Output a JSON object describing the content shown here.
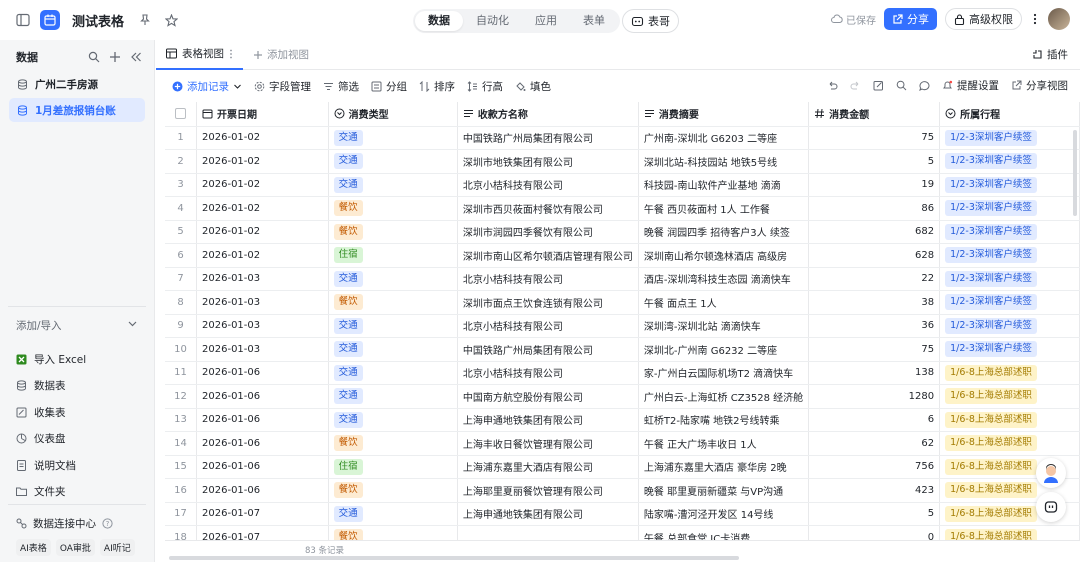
{
  "app": {
    "title": "测试表格"
  },
  "top_tabs": [
    {
      "label": "数据",
      "active": true
    },
    {
      "label": "自动化",
      "active": false
    },
    {
      "label": "应用",
      "active": false
    },
    {
      "label": "表单",
      "active": false
    }
  ],
  "biaoge": "表哥",
  "saved_label": "已保存",
  "share_label": "分享",
  "perm_label": "高级权限",
  "sidebar": {
    "title": "数据",
    "tables": [
      {
        "label": "广州二手房源",
        "active": false
      },
      {
        "label": "1月差旅报销台账",
        "active": true
      }
    ],
    "add_import": "添加/导入",
    "import_items": [
      "导入 Excel",
      "数据表",
      "收集表",
      "仪表盘",
      "说明文档",
      "文件夹"
    ],
    "connect_label": "数据连接中心",
    "chips": [
      "AI表格",
      "OA审批",
      "AI听记"
    ]
  },
  "view": {
    "tab": "表格视图",
    "add": "添加视图",
    "plugin": "插件"
  },
  "toolbar": {
    "add_record": "添加记录",
    "fields": "字段管理",
    "filter": "筛选",
    "group": "分组",
    "sort": "排序",
    "row_height": "行高",
    "fill": "填色",
    "remind": "提醒设置",
    "share_view": "分享视图"
  },
  "columns": [
    "开票日期",
    "消费类型",
    "收款方名称",
    "消费摘要",
    "消费金额",
    "所属行程"
  ],
  "colors": {
    "accent": "#3370ff",
    "tag_交通": "#e1eaff",
    "tag_交通_text": "#245bdb",
    "tag_餐饮": "#fdebd2",
    "tag_餐饮_text": "#c25a00",
    "tag_住宿": "#d9f5d6",
    "tag_住宿_text": "#2e8a1f",
    "trip_a": "#e1eaff",
    "trip_a_text": "#245bdb",
    "trip_b": "#fef3c8",
    "trip_b_text": "#a37b00"
  },
  "rows": [
    {
      "n": "1",
      "date": "2026-01-02",
      "type": "交通",
      "payee": "中国铁路广州局集团有限公司",
      "summary": "广州南-深圳北 G6203 二等座",
      "amount": "75",
      "trip": "1/2-3深圳客户续签"
    },
    {
      "n": "2",
      "date": "2026-01-02",
      "type": "交通",
      "payee": "深圳市地铁集团有限公司",
      "summary": "深圳北站-科技园站 地铁5号线",
      "amount": "5",
      "trip": "1/2-3深圳客户续签"
    },
    {
      "n": "3",
      "date": "2026-01-02",
      "type": "交通",
      "payee": "北京小桔科技有限公司",
      "summary": "科技园-南山软件产业基地 滴滴",
      "amount": "19",
      "trip": "1/2-3深圳客户续签"
    },
    {
      "n": "4",
      "date": "2026-01-02",
      "type": "餐饮",
      "payee": "深圳市西贝莜面村餐饮有限公司",
      "summary": "午餐 西贝莜面村 1人 工作餐",
      "amount": "86",
      "trip": "1/2-3深圳客户续签"
    },
    {
      "n": "5",
      "date": "2026-01-02",
      "type": "餐饮",
      "payee": "深圳市润园四季餐饮有限公司",
      "summary": "晚餐 润园四季 招待客户3人 续签",
      "amount": "682",
      "trip": "1/2-3深圳客户续签"
    },
    {
      "n": "6",
      "date": "2026-01-02",
      "type": "住宿",
      "payee": "深圳市南山区希尔顿酒店管理有限公司",
      "summary": "深圳南山希尔顿逸林酒店 高级房",
      "amount": "628",
      "trip": "1/2-3深圳客户续签"
    },
    {
      "n": "7",
      "date": "2026-01-03",
      "type": "交通",
      "payee": "北京小桔科技有限公司",
      "summary": "酒店-深圳湾科技生态园 滴滴快车",
      "amount": "22",
      "trip": "1/2-3深圳客户续签"
    },
    {
      "n": "8",
      "date": "2026-01-03",
      "type": "餐饮",
      "payee": "深圳市面点王饮食连锁有限公司",
      "summary": "午餐 面点王 1人",
      "amount": "38",
      "trip": "1/2-3深圳客户续签"
    },
    {
      "n": "9",
      "date": "2026-01-03",
      "type": "交通",
      "payee": "北京小桔科技有限公司",
      "summary": "深圳湾-深圳北站 滴滴快车",
      "amount": "36",
      "trip": "1/2-3深圳客户续签"
    },
    {
      "n": "10",
      "date": "2026-01-03",
      "type": "交通",
      "payee": "中国铁路广州局集团有限公司",
      "summary": "深圳北-广州南 G6232 二等座",
      "amount": "75",
      "trip": "1/2-3深圳客户续签"
    },
    {
      "n": "11",
      "date": "2026-01-06",
      "type": "交通",
      "payee": "北京小桔科技有限公司",
      "summary": "家-广州白云国际机场T2 滴滴快车",
      "amount": "138",
      "trip": "1/6-8上海总部述职"
    },
    {
      "n": "12",
      "date": "2026-01-06",
      "type": "交通",
      "payee": "中国南方航空股份有限公司",
      "summary": "广州白云-上海虹桥 CZ3528 经济舱",
      "amount": "1280",
      "trip": "1/6-8上海总部述职"
    },
    {
      "n": "13",
      "date": "2026-01-06",
      "type": "交通",
      "payee": "上海申通地铁集团有限公司",
      "summary": "虹桥T2-陆家嘴 地铁2号线转乘",
      "amount": "6",
      "trip": "1/6-8上海总部述职"
    },
    {
      "n": "14",
      "date": "2026-01-06",
      "type": "餐饮",
      "payee": "上海丰收日餐饮管理有限公司",
      "summary": "午餐 正大广场丰收日 1人",
      "amount": "62",
      "trip": "1/6-8上海总部述职"
    },
    {
      "n": "15",
      "date": "2026-01-06",
      "type": "住宿",
      "payee": "上海浦东嘉里大酒店有限公司",
      "summary": "上海浦东嘉里大酒店 豪华房 2晚",
      "amount": "756",
      "trip": "1/6-8上海总部述职"
    },
    {
      "n": "16",
      "date": "2026-01-06",
      "type": "餐饮",
      "payee": "上海耶里夏丽餐饮管理有限公司",
      "summary": "晚餐 耶里夏丽新疆菜 与VP沟通",
      "amount": "423",
      "trip": "1/6-8上海总部述职"
    },
    {
      "n": "17",
      "date": "2026-01-07",
      "type": "交通",
      "payee": "上海申通地铁集团有限公司",
      "summary": "陆家嘴-漕河泾开发区 14号线",
      "amount": "5",
      "trip": "1/6-8上海总部述职"
    },
    {
      "n": "18",
      "date": "2026-01-07",
      "type": "餐饮",
      "payee": "",
      "summary": "午餐 总部食堂 IC卡消费",
      "amount": "0",
      "trip": "1/6-8上海总部述职"
    }
  ],
  "footer": {
    "count": "83 条记录"
  }
}
